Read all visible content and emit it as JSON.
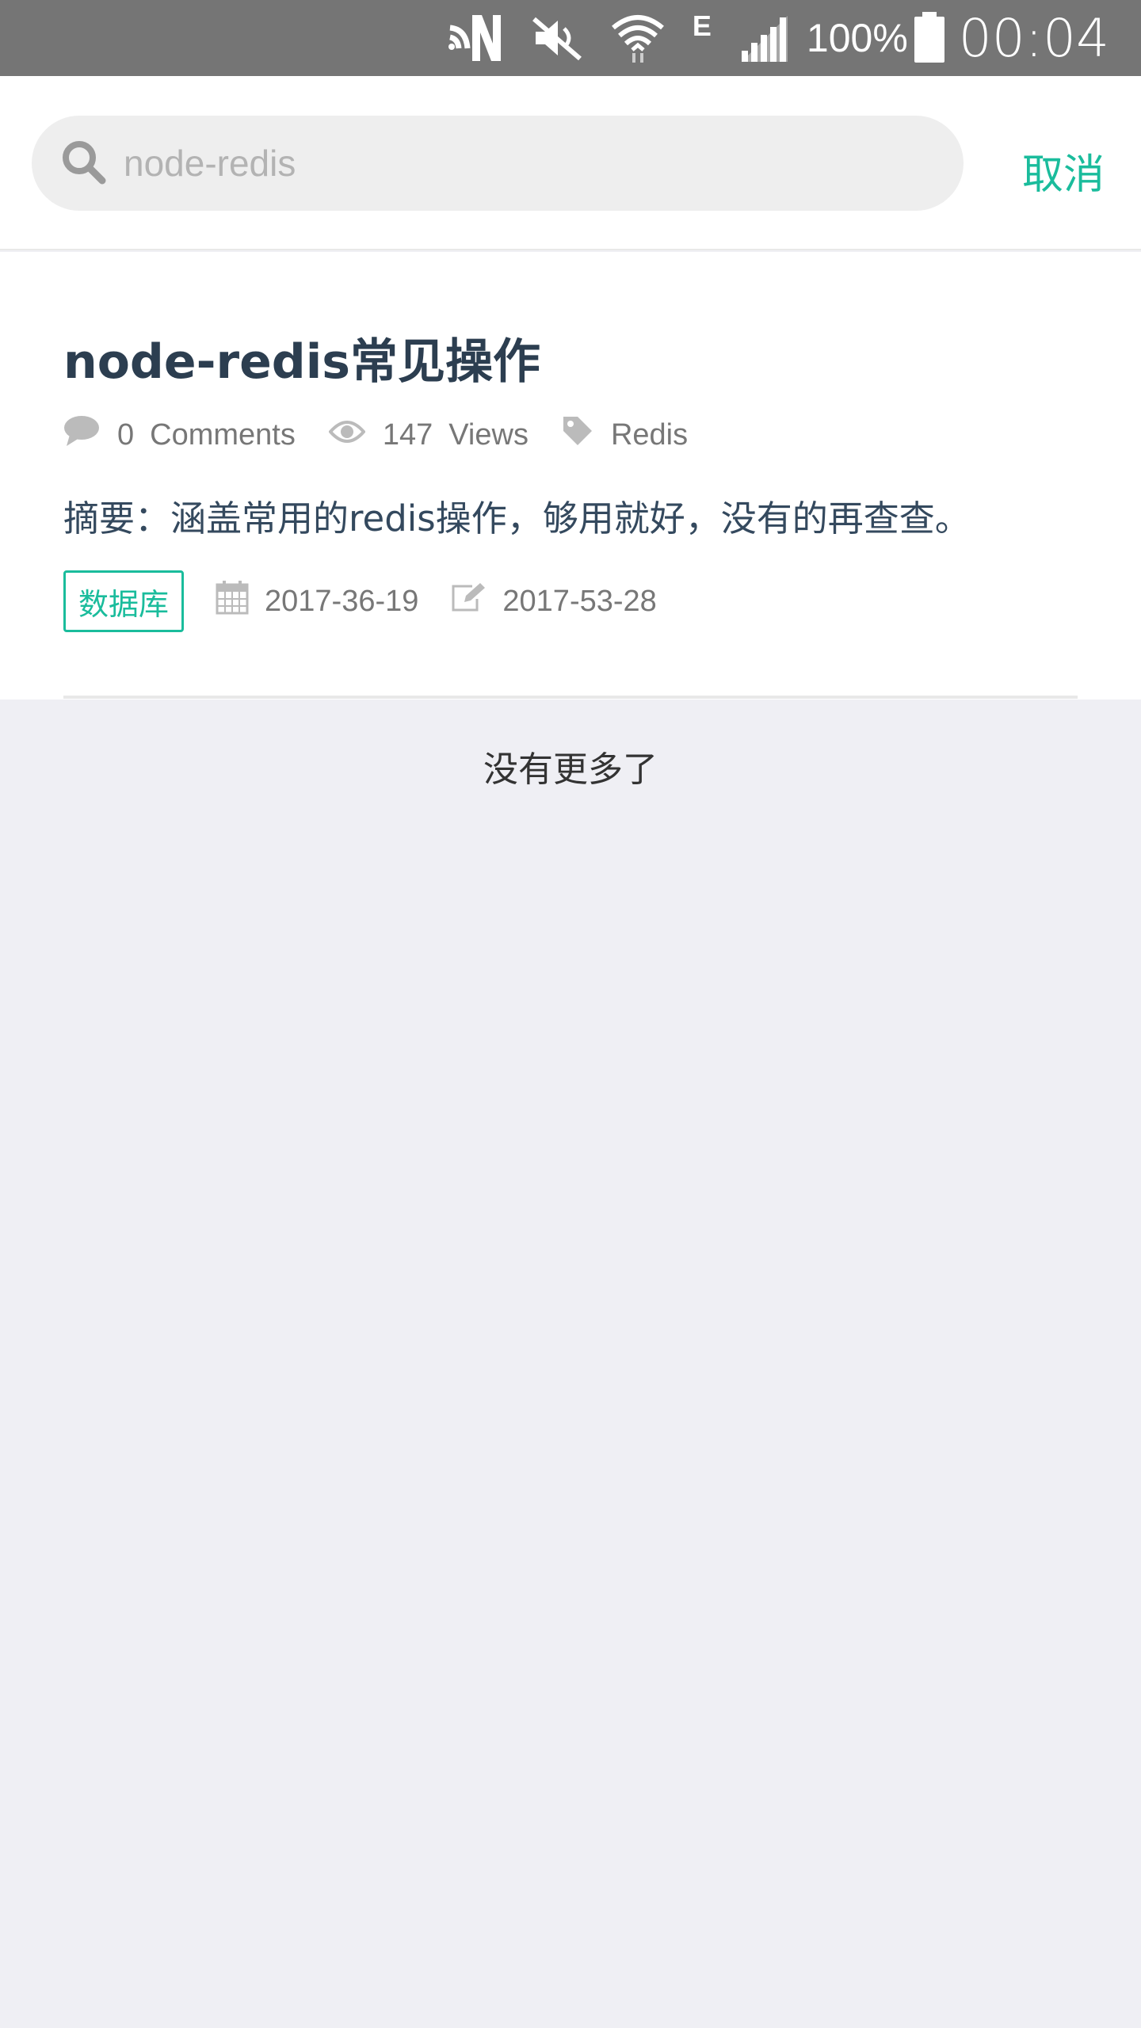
{
  "status_bar": {
    "network_letter": "E",
    "battery_percent": "100%",
    "clock": "00:04"
  },
  "search": {
    "value": "",
    "placeholder": "node-redis",
    "cancel_label": "取消"
  },
  "article": {
    "title": "node-redis常见操作",
    "comments_count": "0",
    "comments_label": "Comments",
    "views_count": "147",
    "views_label": "Views",
    "tag": "Redis",
    "summary": "摘要：涵盖常用的redis操作，够用就好，没有的再查查。",
    "category": "数据库",
    "created_date": "2017-36-19",
    "updated_date": "2017-53-28"
  },
  "list_end_text": "没有更多了",
  "colors": {
    "accent": "#1abc9c",
    "title": "#2c3e50",
    "status_bar": "#757575",
    "page_bg": "#efeff4"
  },
  "icons": [
    "cast-icon",
    "mute-icon",
    "wifi-icon",
    "signal-icon",
    "battery-icon",
    "search-icon",
    "comment-icon",
    "eye-icon",
    "tag-icon",
    "calendar-icon",
    "edit-icon"
  ]
}
